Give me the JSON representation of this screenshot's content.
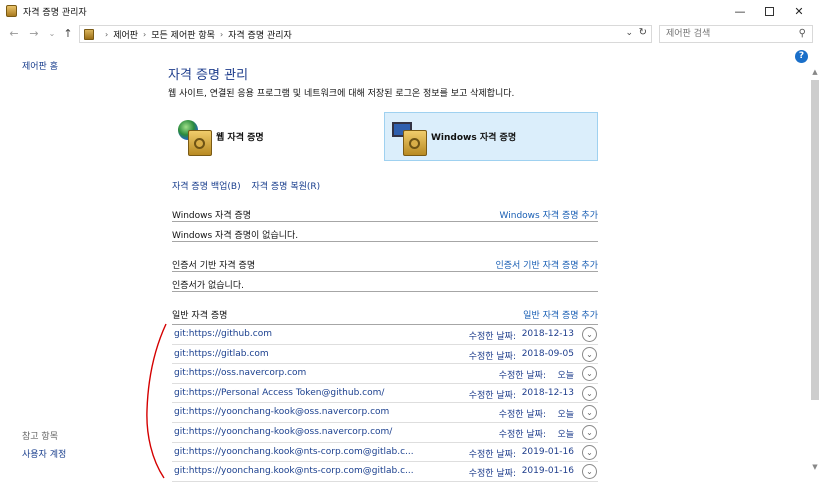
{
  "window": {
    "title": "자격 증명 관리자"
  },
  "address": {
    "breadcrumbs": [
      "제어판",
      "모든 제어판 항목",
      "자격 증명 관리자"
    ],
    "search_placeholder": "제어판 검색"
  },
  "left_nav": {
    "home": "제어판 홈",
    "see_also": "참고 항목",
    "user_accounts": "사용자 계정"
  },
  "main": {
    "title": "자격 증명 관리",
    "description": "웹 사이트, 연결된 응용 프로그램 및 네트워크에 대해 저장된 로그온 정보를 보고 삭제합니다.",
    "categories": [
      {
        "label": "웹 자격 증명",
        "icon": "web-credentials-icon",
        "selected": false
      },
      {
        "label": "Windows 자격 증명",
        "icon": "windows-credentials-icon",
        "selected": true
      }
    ],
    "backup_label": "자격 증명 백업(B)",
    "restore_label": "자격 증명 복원(R)",
    "windows_section": {
      "heading": "Windows 자격 증명",
      "add_label": "Windows 자격 증명 추가",
      "empty_text": "Windows 자격 증명이 없습니다."
    },
    "certificate_section": {
      "heading": "인증서 기반 자격 증명",
      "add_label": "인증서 기반 자격 증명 추가",
      "empty_text": "인증서가 없습니다."
    },
    "generic_section": {
      "heading": "일반 자격 증명",
      "add_label": "일반 자격 증명 추가",
      "modified_label": "수정한 날짜:",
      "items": [
        {
          "name": "git:https://github.com",
          "modified": "2018-12-13"
        },
        {
          "name": "git:https://gitlab.com",
          "modified": "2018-09-05"
        },
        {
          "name": "git:https://oss.navercorp.com",
          "modified": "오늘"
        },
        {
          "name": "git:https://Personal Access Token@github.com/",
          "modified": "2018-12-13"
        },
        {
          "name": "git:https://yoonchang-kook@oss.navercorp.com",
          "modified": "오늘"
        },
        {
          "name": "git:https://yoonchang-kook@oss.navercorp.com/",
          "modified": "오늘"
        },
        {
          "name": "git:https://yoonchang.kook@nts-corp.com@gitlab.c...",
          "modified": "2019-01-16"
        },
        {
          "name": "git:https://yoonchang.kook@nts-corp.com@gitlab.c...",
          "modified": "2019-01-16"
        }
      ]
    }
  },
  "colors": {
    "link": "#1a3f8e",
    "title": "#1e3d8c",
    "selected_tile_bg": "#dbeefb",
    "annotation": "#d40000"
  }
}
